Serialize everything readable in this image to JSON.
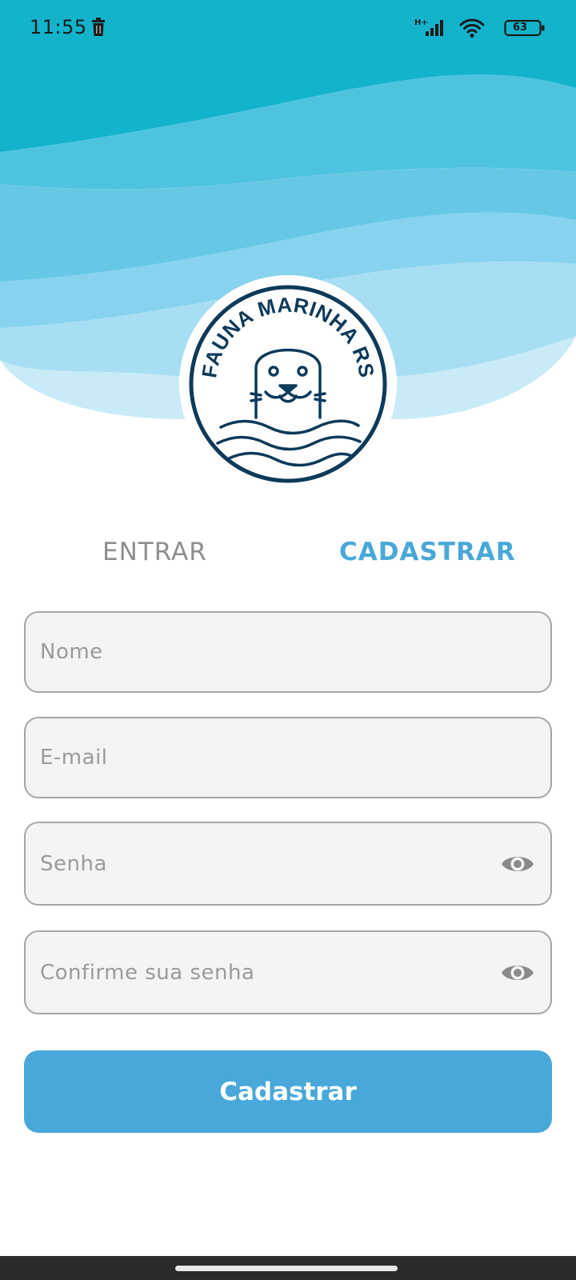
{
  "status_bar": {
    "time": "11:55",
    "network_type": "H+",
    "battery_level": "63",
    "icons": [
      "trash-icon",
      "signal-icon",
      "wifi-icon",
      "battery-icon"
    ]
  },
  "logo": {
    "text": "FAUNA MARINHA RS",
    "icon": "seal-icon"
  },
  "tabs": {
    "login_label": "ENTRAR",
    "register_label": "CADASTRAR",
    "active": "CADASTRAR"
  },
  "form": {
    "name_placeholder": "Nome",
    "name_value": "",
    "email_placeholder": "E-mail",
    "email_value": "",
    "password_placeholder": "Senha",
    "password_value": "",
    "confirm_placeholder": "Confirme sua senha",
    "confirm_value": "",
    "password_toggle_icon": "eye-icon",
    "submit_label": "Cadastrar"
  },
  "colors": {
    "accent": "#4aa8d8",
    "button": "#48a8da",
    "inactive_tab": "#8e8e8e",
    "logo_navy": "#0e3a5a",
    "wave_dark": "#1bb2cc",
    "wave_light": "#cdeef8"
  }
}
